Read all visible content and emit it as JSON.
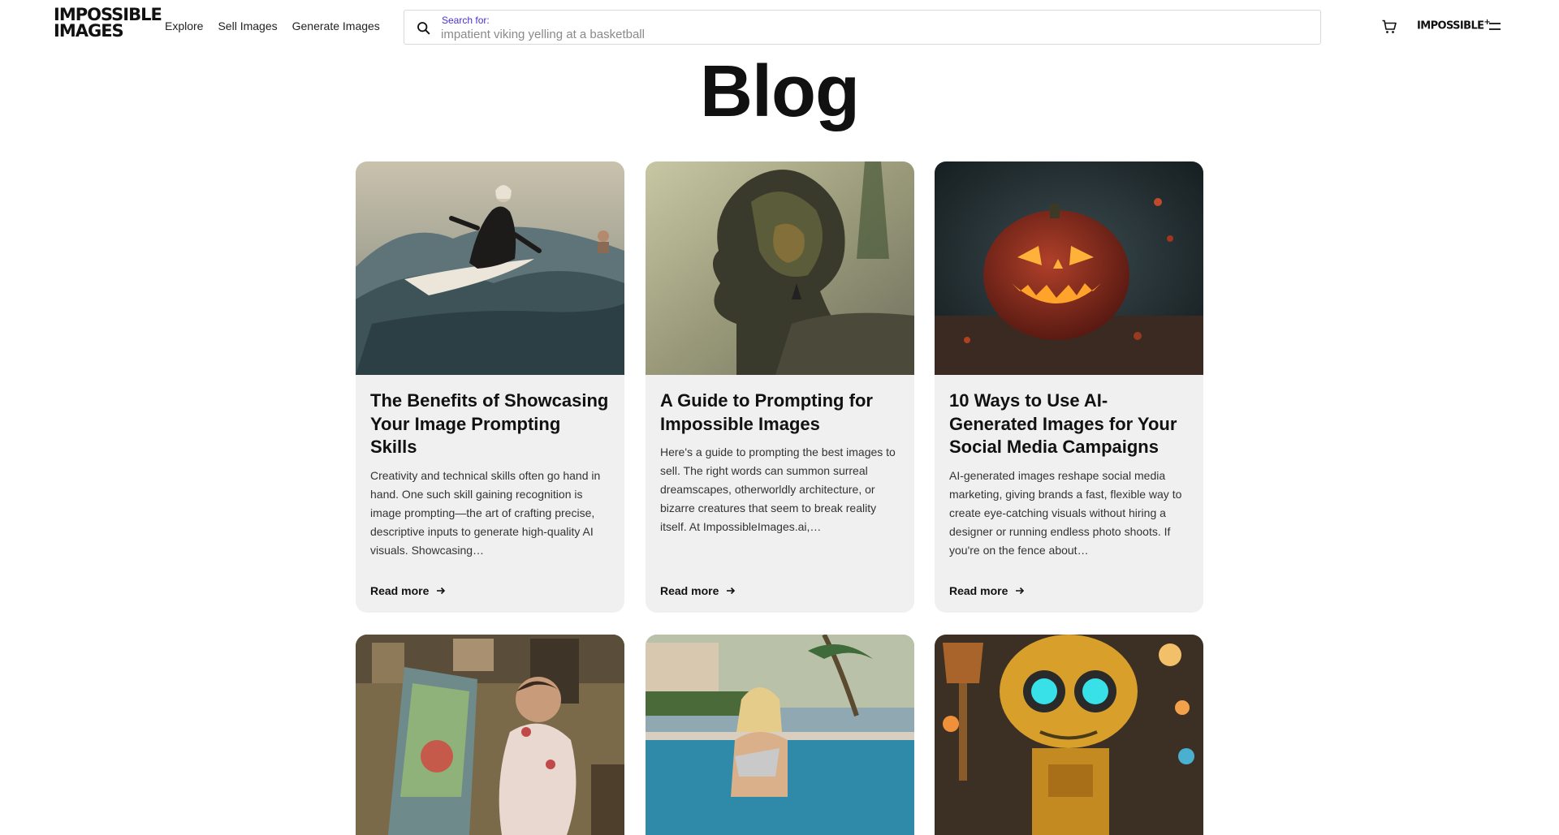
{
  "header": {
    "logo_line1": "IMPOSSIBLE",
    "logo_line2": "IMAGES",
    "nav": [
      "Explore",
      "Sell Images",
      "Generate Images"
    ],
    "search_label": "Search for:",
    "search_placeholder": "impatient viking yelling at a basketball",
    "plus_logo": "IMPOSSIBLE",
    "plus_logo_sup": "+"
  },
  "page_title": "Blog",
  "posts": [
    {
      "title": "The Benefits of Showcasing Your Image Prompting Skills",
      "excerpt": "Creativity and technical skills often go hand in hand. One such skill gaining recognition is image prompting—the art of crafting precise, descriptive inputs to generate high-quality AI visuals. Showcasing…",
      "read_more": "Read more"
    },
    {
      "title": "A Guide to Prompting for Impossible Images",
      "excerpt": "Here's a guide to prompting the best images to sell. The right words can summon surreal dreamscapes, otherworldly architecture, or bizarre creatures that seem to break reality itself. At ImpossibleImages.ai,…",
      "read_more": "Read more"
    },
    {
      "title": "10 Ways to Use AI-Generated Images for Your Social Media Campaigns",
      "excerpt": "AI-generated images reshape social media marketing, giving brands a fast, flexible way to create eye-catching visuals without hiring a designer or running endless photo shoots. If you're on the fence about…",
      "read_more": "Read more"
    }
  ],
  "icons": {
    "search": "search-icon",
    "cart": "cart-icon",
    "menu": "menu-icon",
    "arrow": "arrow-right-icon"
  },
  "colors": {
    "accent": "#4a2fd0",
    "card_bg": "#f0f0f0",
    "text": "#111111"
  }
}
